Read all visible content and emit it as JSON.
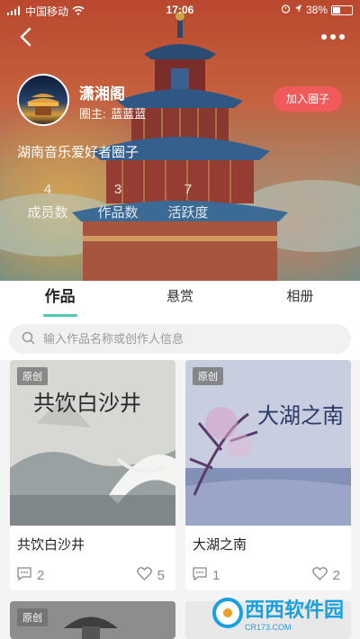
{
  "status_bar": {
    "carrier": "中国移动",
    "time": "17:06",
    "battery": "38%"
  },
  "header": {
    "circle_name": "潇湘阁",
    "owner_label": "圈主:",
    "owner_name": "蓝蓝蓝",
    "join_label": "加入圈子",
    "description": "湖南音乐爱好者圈子",
    "stats": [
      {
        "value": "4",
        "label": "成员数"
      },
      {
        "value": "3",
        "label": "作品数"
      },
      {
        "value": "7",
        "label": "活跃度"
      }
    ]
  },
  "tabs": [
    {
      "label": "作品",
      "active": true
    },
    {
      "label": "悬赏",
      "active": false
    },
    {
      "label": "相册",
      "active": false
    }
  ],
  "search": {
    "placeholder": "输入作品名称或创作人信息"
  },
  "works": [
    {
      "tag": "原创",
      "title": "共饮白沙井",
      "comments": "2",
      "likes": "5"
    },
    {
      "tag": "原创",
      "title": "大湖之南",
      "comments": "1",
      "likes": "2"
    },
    {
      "tag": "原创"
    }
  ],
  "cover_art_text": {
    "work_1": "共饮白沙井",
    "work_2": "大湖之南"
  },
  "watermark": {
    "brand": "西西软件园",
    "url": "CR173.COM"
  },
  "colors": {
    "accent": "#4cc9b0",
    "join_button": "#f05a5a",
    "watermark": "#1a9fe0"
  }
}
